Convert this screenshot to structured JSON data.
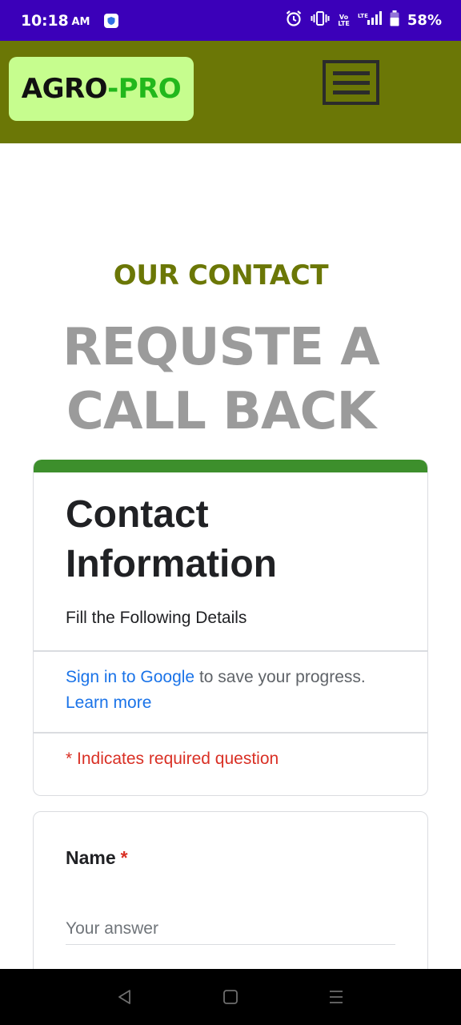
{
  "status_bar": {
    "time": "10:18",
    "ampm": "AM",
    "network_top": "Vo",
    "network_bottom": "LTE",
    "battery": "58%"
  },
  "header": {
    "logo_part_1": "AGRO",
    "logo_dash": "-",
    "logo_part_2": "PRO"
  },
  "section": {
    "eyebrow": "OUR CONTACT",
    "title_line_1": "REQUSTE A",
    "title_line_2": "CALL BACK"
  },
  "form": {
    "title_line_1": "Contact",
    "title_line_2": "Information",
    "description": "Fill the Following Details",
    "signin_link": "Sign in to Google",
    "signin_text": " to save your progress.",
    "learn_more": "Learn more",
    "required_note": "* Indicates required question",
    "questions": [
      {
        "label": "Name",
        "asterisk": "*",
        "placeholder": "Your answer"
      }
    ]
  },
  "colors": {
    "status_bar": "#3b00b9",
    "header": "#6b7706",
    "logo_bg": "#c6fd8e",
    "accent_green": "#22b81c",
    "form_accent": "#3d8f2c",
    "link": "#1a73e8",
    "required": "#d93025"
  },
  "icons": {
    "status_app": "shield-app-icon",
    "alarm": "alarm-icon",
    "vibrate": "vibrate-icon",
    "signal": "signal-icon",
    "battery": "battery-icon",
    "menu": "hamburger-menu-icon",
    "nav_back": "back-triangle-icon",
    "nav_home": "home-square-icon",
    "nav_recents": "recents-lines-icon"
  }
}
